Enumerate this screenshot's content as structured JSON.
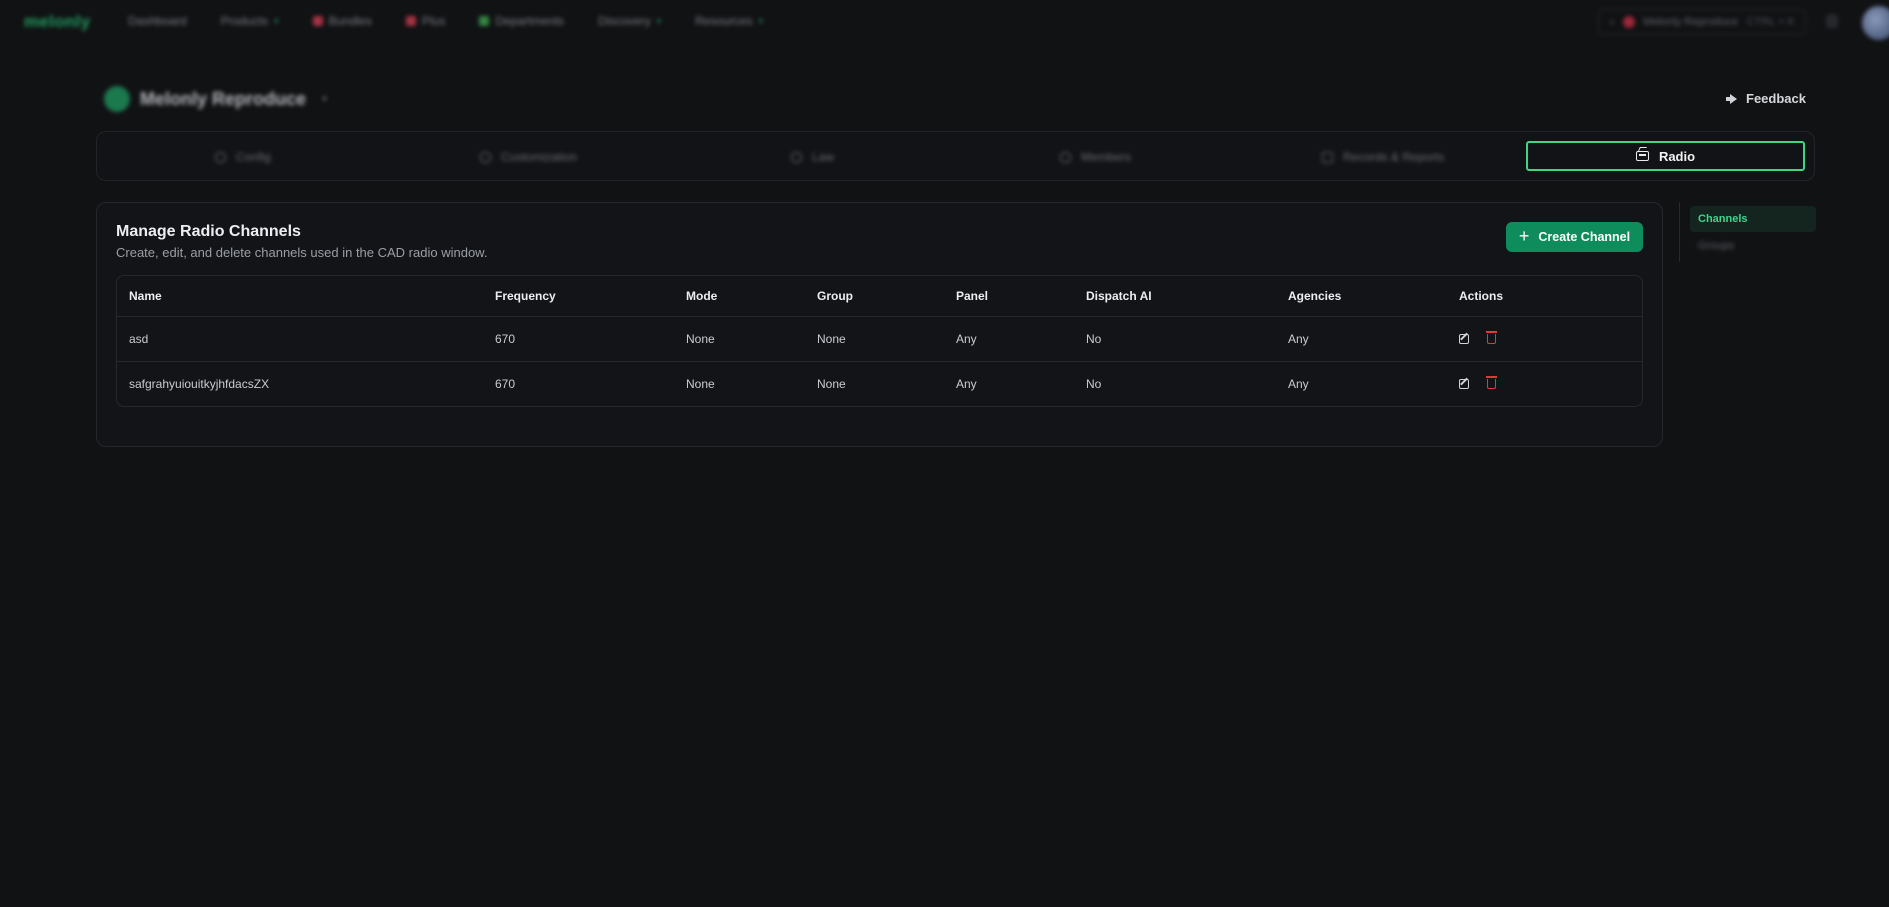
{
  "nav": {
    "logo": "melonly",
    "items": [
      {
        "label": "Dashboard",
        "icon": ""
      },
      {
        "label": "Products",
        "icon": "chevron"
      },
      {
        "label": "Bundles",
        "icon": "bundles-icon",
        "color": "#c23a4b"
      },
      {
        "label": "Plus",
        "icon": "plus-icon",
        "color": "#c23a4b"
      },
      {
        "label": "Departments",
        "icon": "departments-icon",
        "color": "#3a9a4c"
      },
      {
        "label": "Discovery",
        "icon": "chevron"
      },
      {
        "label": "Resources",
        "icon": "chevron"
      }
    ],
    "search_text": "Melonly Reproduce",
    "search_kbd": "CTRL + K"
  },
  "server": {
    "name": "Melonly Reproduce"
  },
  "feedback_label": "Feedback",
  "tabs": [
    {
      "label": "Config",
      "active": false
    },
    {
      "label": "Customization",
      "active": false
    },
    {
      "label": "Law",
      "active": false
    },
    {
      "label": "Members",
      "active": false
    },
    {
      "label": "Records & Reports",
      "active": false
    },
    {
      "label": "Radio",
      "active": true
    }
  ],
  "card": {
    "title": "Manage Radio Channels",
    "subtitle": "Create, edit, and delete channels used in the CAD radio window.",
    "create_label": "Create Channel"
  },
  "table": {
    "columns": [
      "Name",
      "Frequency",
      "Mode",
      "Group",
      "Panel",
      "Dispatch AI",
      "Agencies",
      "Actions"
    ],
    "rows": [
      [
        "asd",
        "670",
        "None",
        "None",
        "Any",
        "No",
        "Any"
      ],
      [
        "safgrahyuiouitkyjhfdacsZX",
        "670",
        "None",
        "None",
        "Any",
        "No",
        "Any"
      ]
    ]
  },
  "subnav": {
    "items": [
      {
        "label": "Channels",
        "active": true
      },
      {
        "label": "Groups",
        "active": false
      }
    ]
  },
  "colors": {
    "accent": "#3cd685",
    "button": "#0f8c5c",
    "danger": "#e0393b",
    "background": "#111214"
  }
}
